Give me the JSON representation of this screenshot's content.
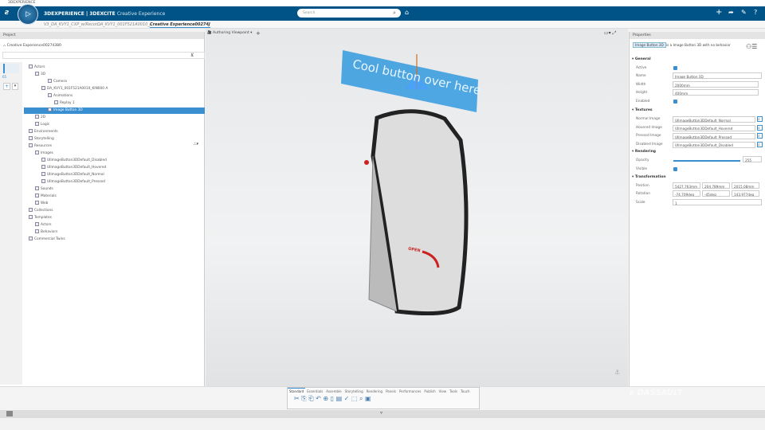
{
  "app": {
    "window_title": "3DEXPERIENCE",
    "brand": "3DEXPERIENCE | 3DEXCITE",
    "product": "Creative Experience",
    "search_placeholder": "Search"
  },
  "tabs": [
    {
      "label": "V3_DA_KVY1_CXP_w/Recor...",
      "active": false
    },
    {
      "label": "DA_KVY1_001F521A0010_/",
      "active": false
    },
    {
      "label": "Creative Experience00274J",
      "active": true
    }
  ],
  "project": {
    "panel_title": "Project",
    "root": "Creative Experience00274380",
    "scale_label": "65",
    "tree": [
      {
        "label": "Actors",
        "indent": 0
      },
      {
        "label": "3D",
        "indent": 1
      },
      {
        "label": "Camera",
        "indent": 3
      },
      {
        "label": "DA_KVY1_001F521A0010_KIN000 A",
        "indent": 2
      },
      {
        "label": "Animations",
        "indent": 3
      },
      {
        "label": "Replay 1",
        "indent": 4
      },
      {
        "label": "Image Button 3D",
        "indent": 3,
        "selected": true
      },
      {
        "label": "2D",
        "indent": 1
      },
      {
        "label": "Logic",
        "indent": 1
      },
      {
        "label": "Environments",
        "indent": 0
      },
      {
        "label": "Storytelling",
        "indent": 0
      },
      {
        "label": "Resources",
        "indent": 0
      },
      {
        "label": "Images",
        "indent": 1
      },
      {
        "label": "UIImageButton3DDefault_Disabled",
        "indent": 2
      },
      {
        "label": "UIImageButton3DDefault_Hovered",
        "indent": 2
      },
      {
        "label": "UIImageButton3DDefault_Normal",
        "indent": 2
      },
      {
        "label": "UIImageButton3DDefault_Pressed",
        "indent": 2
      },
      {
        "label": "Sounds",
        "indent": 1
      },
      {
        "label": "Materials",
        "indent": 1
      },
      {
        "label": "Web",
        "indent": 1
      },
      {
        "label": "Collections",
        "indent": 0
      },
      {
        "label": "Templates",
        "indent": 0
      },
      {
        "label": "Actors",
        "indent": 1
      },
      {
        "label": "Behaviors",
        "indent": 1
      },
      {
        "label": "Commercial Twins",
        "indent": 0
      }
    ]
  },
  "viewport": {
    "viewpoint": "Authoring Viewpoint",
    "button_text": "Cool button over here",
    "door_label": "OPEN"
  },
  "properties": {
    "panel_title": "Properties",
    "object_chip": "Image Button 3D",
    "object_desc": "is a Image Button 3D with no behavior",
    "general": {
      "title": "General",
      "active_label": "Active",
      "name_label": "Name",
      "name": "Image Button 3D",
      "width_label": "Width",
      "width": "2000mm",
      "height_label": "Height",
      "height": "400mm",
      "enabled_label": "Enabled"
    },
    "textures": {
      "title": "Textures",
      "rows": [
        {
          "label": "Normal Image",
          "value": "UIImageButton3DDefault_Normal"
        },
        {
          "label": "Hovered Image",
          "value": "UIImageButton3DDefault_Hovered"
        },
        {
          "label": "Pressed Image",
          "value": "UIImageButton3DDefault_Pressed"
        },
        {
          "label": "Disabled Image",
          "value": "UIImageButton3DDefault_Disabled"
        }
      ]
    },
    "rendering": {
      "title": "Rendering",
      "opacity_label": "Opacity",
      "opacity": "255",
      "visible_label": "Visible"
    },
    "transformation": {
      "title": "Transformation",
      "position_label": "Position",
      "position": [
        "5427.763mm",
        "204.789mm",
        "2015.08mm"
      ],
      "rotation_label": "Rotation",
      "rotation": [
        "-74.709deg",
        "-45deg",
        "143.977deg"
      ],
      "scale_label": "Scale",
      "scale": "1"
    }
  },
  "actionbar": {
    "tabs": [
      "Standard",
      "Essentials",
      "Assemble",
      "Storytelling",
      "Rendering",
      "Panels",
      "Performances",
      "Publish",
      "View",
      "Tools",
      "Touch"
    ],
    "active": "Standard"
  },
  "colors": {
    "header": "#005386",
    "selection": "#3a8fd1"
  }
}
